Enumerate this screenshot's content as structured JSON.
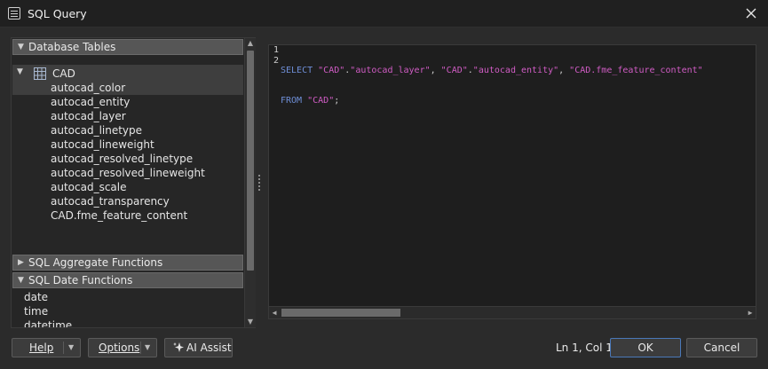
{
  "window": {
    "title": "SQL Query",
    "icons": {
      "app": "table-icon",
      "close": "close-icon"
    }
  },
  "left": {
    "database_tables_header": "Database Tables",
    "tree": {
      "root_label": "CAD",
      "children": [
        "autocad_color",
        "autocad_entity",
        "autocad_layer",
        "autocad_linetype",
        "autocad_lineweight",
        "autocad_resolved_linetype",
        "autocad_resolved_lineweight",
        "autocad_scale",
        "autocad_transparency",
        "CAD.fme_feature_content"
      ]
    },
    "aggregate_header": "SQL Aggregate Functions",
    "date_header": "SQL Date Functions",
    "date_items": [
      "date",
      "time",
      "datetime"
    ]
  },
  "editor": {
    "line_numbers": [
      "1",
      "2"
    ],
    "line1": {
      "kw": "SELECT ",
      "s1": "\"CAD\"",
      "p1": ".",
      "s2": "\"autocad_layer\"",
      "p2": ", ",
      "s3": "\"CAD\"",
      "p3": ".",
      "s4": "\"autocad_entity\"",
      "p4": ", ",
      "s5": "\"CAD.fme_feature_content\""
    },
    "line2": {
      "kw": "FROM ",
      "s1": "\"CAD\"",
      "p1": ";"
    }
  },
  "footer": {
    "help": "Help",
    "options": "Options",
    "ai_assist": "AI Assist",
    "status": "Ln 1, Col 1",
    "ok": "OK",
    "cancel": "Cancel"
  },
  "colors": {
    "keyword": "#6f8fd8",
    "string": "#d05cc4",
    "accent": "#4a78b8"
  }
}
